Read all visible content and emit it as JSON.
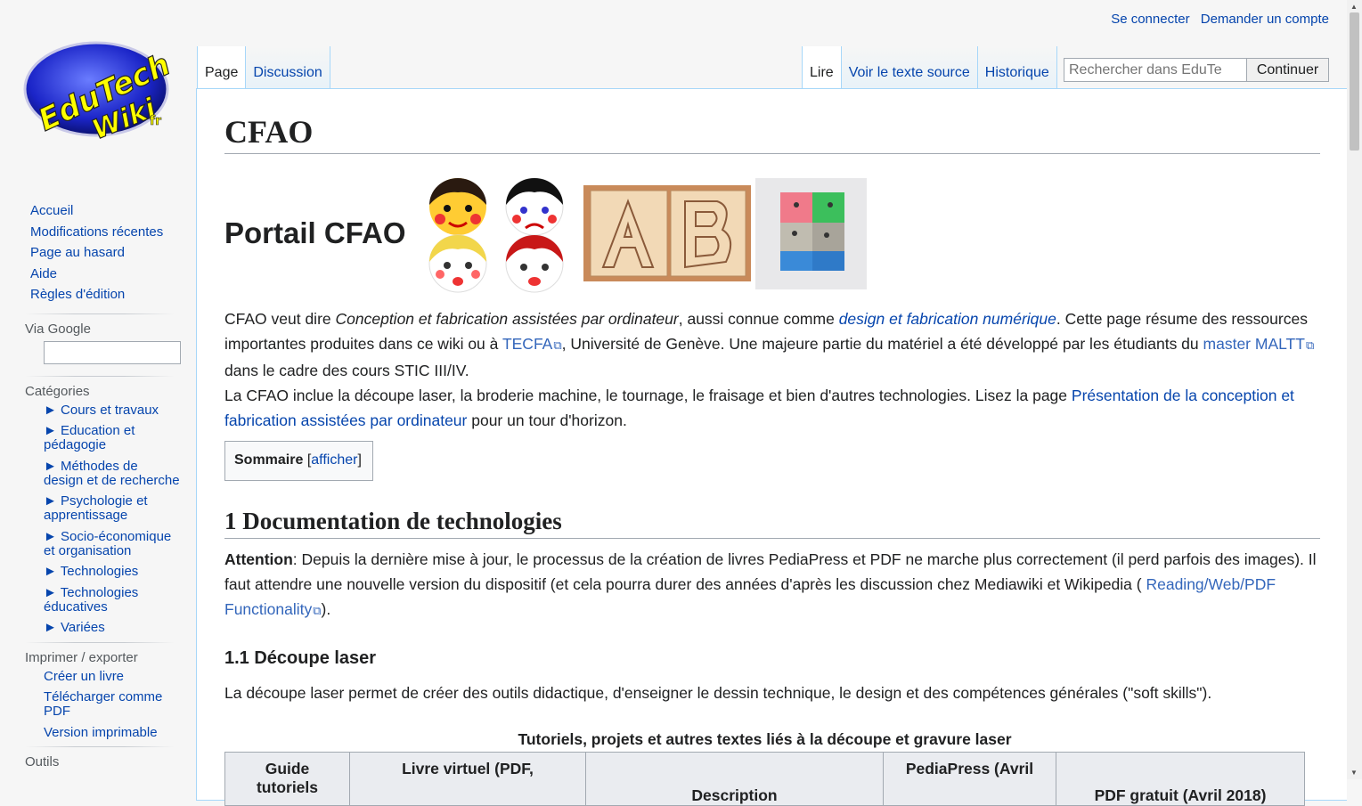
{
  "personal": {
    "login": "Se connecter",
    "create_account": "Demander un compte"
  },
  "logo": {
    "line1": "EduTech",
    "line2": "Wiki",
    "suffix": "fr"
  },
  "tabs": {
    "page": "Page",
    "discussion": "Discussion",
    "read": "Lire",
    "source": "Voir le texte source",
    "history": "Historique"
  },
  "search": {
    "placeholder": "Rechercher dans EduTe",
    "button": "Continuer"
  },
  "sidebar": {
    "nav": [
      "Accueil",
      "Modifications récentes",
      "Page au hasard",
      "Aide",
      "Règles d'édition"
    ],
    "google_heading": "Via Google",
    "categories_heading": "Catégories",
    "categories": [
      "► Cours et travaux",
      "► Education et pédagogie",
      "► Méthodes de design et de recherche",
      "► Psychologie et apprentissage",
      "► Socio-économique et organisation",
      "► Technologies",
      "► Technologies éducatives",
      "► Variées"
    ],
    "print_heading": "Imprimer / exporter",
    "print": [
      "Créer un livre",
      "Télécharger comme PDF",
      "Version imprimable"
    ],
    "tools_heading": "Outils"
  },
  "content": {
    "title": "CFAO",
    "portal_title": "Portail CFAO",
    "p1": {
      "t1": "CFAO veut dire ",
      "em1": "Conception et fabrication assistées par ordinateur",
      "t2": ", aussi connue comme ",
      "link1": "design et fabrication numérique",
      "t3": ". Cette page résume des ressources importantes produites dans ce wiki ou à ",
      "link2": "TECFA",
      "t4": ", Université de Genève. Une majeure partie du matériel a été développé par les étudiants du ",
      "link3": "master MALTT",
      "t5": " dans le cadre des cours STIC III/IV."
    },
    "p2": {
      "t1": "La CFAO inclue la découpe laser, la broderie machine, le tournage, le fraisage et bien d'autres technologies. Lisez la page ",
      "link": "Présentation de la conception et fabrication assistées par ordinateur",
      "t2": " pour un tour d'horizon."
    },
    "toc": {
      "title": "Sommaire",
      "open": "[",
      "toggle": "afficher",
      "close": "]"
    },
    "h2": "1 Documentation de technologies",
    "p3": {
      "strong": "Attention",
      "t1": ": Depuis la dernière mise à jour, le processus de la création de livres PediaPress et PDF ne marche plus correctement (il perd parfois des images). Il faut attendre une nouvelle version du dispositif (et cela pourra durer des années d'après les discussion chez Mediawiki et Wikipedia ( ",
      "link": "Reading/Web/PDF Functionality",
      "t2": ")."
    },
    "h3": "1.1 Découpe laser",
    "p4": "La découpe laser permet de créer des outils didactique, d'enseigner le dessin technique, le design et des compétences générales (\"soft skills\").",
    "table": {
      "caption": "Tutoriels, projets et autres textes liés à la découpe et gravure laser",
      "headers": [
        "Guide tutoriels",
        "Livre virtuel (PDF,",
        "Description",
        "PediaPress (Avril",
        "PDF gratuit (Avril 2018)"
      ]
    }
  }
}
